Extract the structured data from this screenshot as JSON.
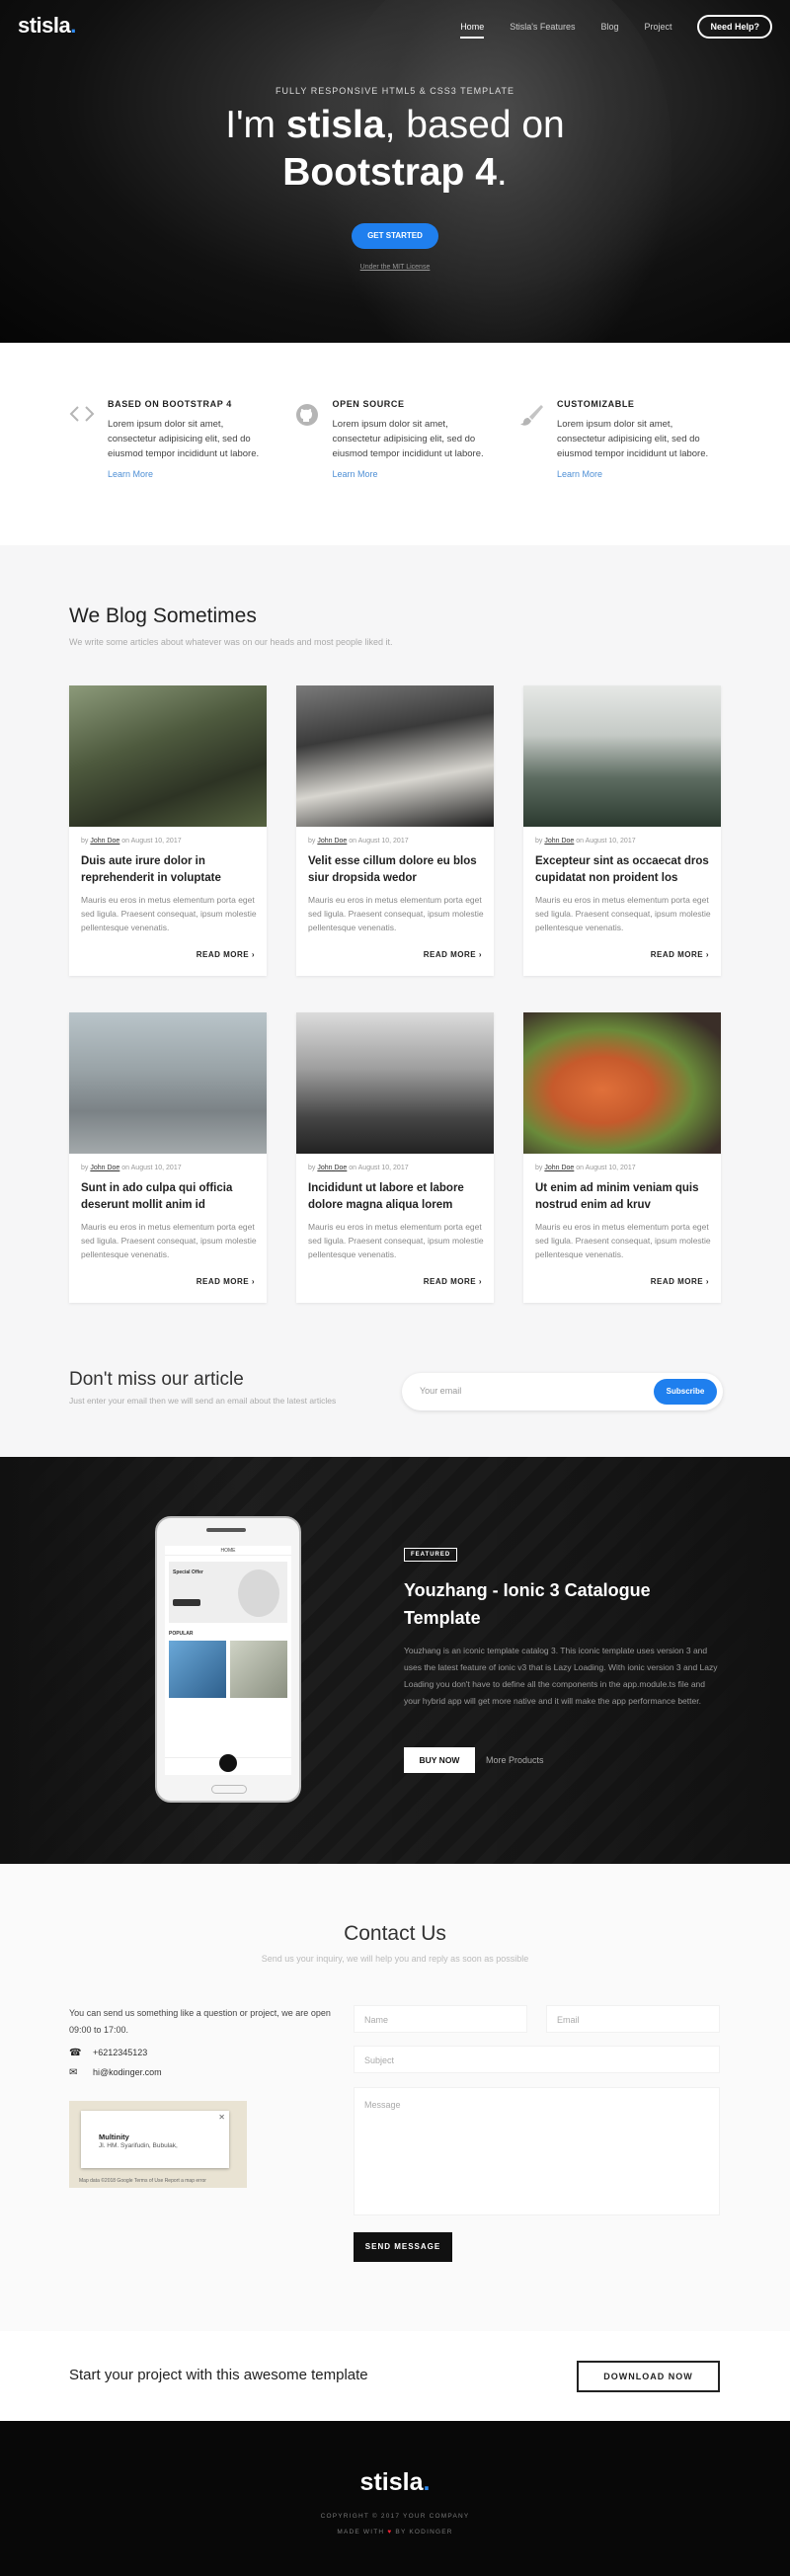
{
  "brand": {
    "name": "stisla",
    "dot": "."
  },
  "nav": {
    "items": [
      "Home",
      "Stisla's Features",
      "Blog",
      "Project"
    ],
    "help": "Need Help?"
  },
  "hero": {
    "subtitle": "FULLY RESPONSIVE HTML5 & CSS3 TEMPLATE",
    "line1_pre": "I'm ",
    "line1_bold": "stisla",
    "line1_post": ", based on",
    "line2_bold": "Bootstrap 4",
    "line2_post": ".",
    "button": "GET STARTED",
    "license": "Under the MIT License"
  },
  "features": [
    {
      "icon": "code-icon",
      "title": "BASED ON BOOTSTRAP 4",
      "text": "Lorem ipsum dolor sit amet, consectetur adipisicing elit, sed do eiusmod tempor incididunt ut labore.",
      "link": "Learn More"
    },
    {
      "icon": "github-icon",
      "title": "OPEN SOURCE",
      "text": "Lorem ipsum dolor sit amet, consectetur adipisicing elit, sed do eiusmod tempor incididunt ut labore.",
      "link": "Learn More"
    },
    {
      "icon": "brush-icon",
      "title": "CUSTOMIZABLE",
      "text": "Lorem ipsum dolor sit amet, consectetur adipisicing elit, sed do eiusmod tempor incididunt ut labore.",
      "link": "Learn More"
    }
  ],
  "blog": {
    "title": "We Blog Sometimes",
    "subtitle": "We write some articles about whatever was on our heads and most people liked it.",
    "posts": [
      {
        "by": "by",
        "author": "John Doe",
        "date": "on August 10, 2017",
        "title": "Duis aute irure dolor in reprehenderit in voluptate",
        "excerpt": "Mauris eu eros in metus elementum porta eget sed ligula. Praesent consequat, ipsum molestie pellentesque venenatis.",
        "more": "READ MORE ›"
      },
      {
        "by": "by",
        "author": "John Doe",
        "date": "on August 10, 2017",
        "title": "Velit esse cillum dolore eu blos siur dropsida wedor",
        "excerpt": "Mauris eu eros in metus elementum porta eget sed ligula. Praesent consequat, ipsum molestie pellentesque venenatis.",
        "more": "READ MORE ›"
      },
      {
        "by": "by",
        "author": "John Doe",
        "date": "on August 10, 2017",
        "title": "Excepteur sint as occaecat dros cupidatat non proident los",
        "excerpt": "Mauris eu eros in metus elementum porta eget sed ligula. Praesent consequat, ipsum molestie pellentesque venenatis.",
        "more": "READ MORE ›"
      },
      {
        "by": "by",
        "author": "John Doe",
        "date": "on August 10, 2017",
        "title": "Sunt in ado culpa qui officia deserunt mollit anim id",
        "excerpt": "Mauris eu eros in metus elementum porta eget sed ligula. Praesent consequat, ipsum molestie pellentesque venenatis.",
        "more": "READ MORE ›"
      },
      {
        "by": "by",
        "author": "John Doe",
        "date": "on August 10, 2017",
        "title": "Incididunt ut labore et labore dolore magna aliqua lorem",
        "excerpt": "Mauris eu eros in metus elementum porta eget sed ligula. Praesent consequat, ipsum molestie pellentesque venenatis.",
        "more": "READ MORE ›"
      },
      {
        "by": "by",
        "author": "John Doe",
        "date": "on August 10, 2017",
        "title": "Ut enim ad minim veniam quis nostrud enim ad kruv",
        "excerpt": "Mauris eu eros in metus elementum porta eget sed ligula. Praesent consequat, ipsum molestie pellentesque venenatis.",
        "more": "READ MORE ›"
      }
    ]
  },
  "newsletter": {
    "title": "Don't miss our article",
    "subtitle": "Just enter your email then we will send an email about the latest articles",
    "placeholder": "Your email",
    "button": "Subscribe"
  },
  "promo": {
    "tag": "FEATURED",
    "title": "Youzhang - Ionic 3 Catalogue Template",
    "text": "Youzhang is an iconic template catalog 3. This iconic template uses version 3 and uses the latest feature of ionic v3 that is Lazy Loading. With ionic version 3 and Lazy Loading you don't have to define all the components in the app.module.ts file and your hybrid app will get more native and it will make the app performance better.",
    "buy": "BUY NOW",
    "more": "More Products",
    "phone": {
      "home": "HOME",
      "banner": "Special Offer",
      "popular": "POPULAR"
    }
  },
  "contact": {
    "title": "Contact Us",
    "subtitle": "Send us your inquiry, we will help you and reply as soon as possible",
    "intro": "You can send us something like a question or project, we are open 09:00 to 17:00.",
    "phone": "+6212345123",
    "email": "hi@kodinger.com",
    "map": {
      "name": "Multinity",
      "address": "Jl. HM. Syarifudin, Bubulak,",
      "footer": "Map data ©2018 Google   Terms of Use   Report a map error"
    },
    "form": {
      "name": "Name",
      "email": "Email",
      "subject": "Subject",
      "message": "Message",
      "send": "SEND MESSAGE"
    }
  },
  "cta": {
    "title": "Start your project with this awesome template",
    "button": "DOWNLOAD NOW"
  },
  "footer": {
    "copyright": "COPYRIGHT © 2017 YOUR COMPANY",
    "made_pre": "MADE WITH",
    "heart": "♥",
    "made_post": "BY KODINGER"
  }
}
